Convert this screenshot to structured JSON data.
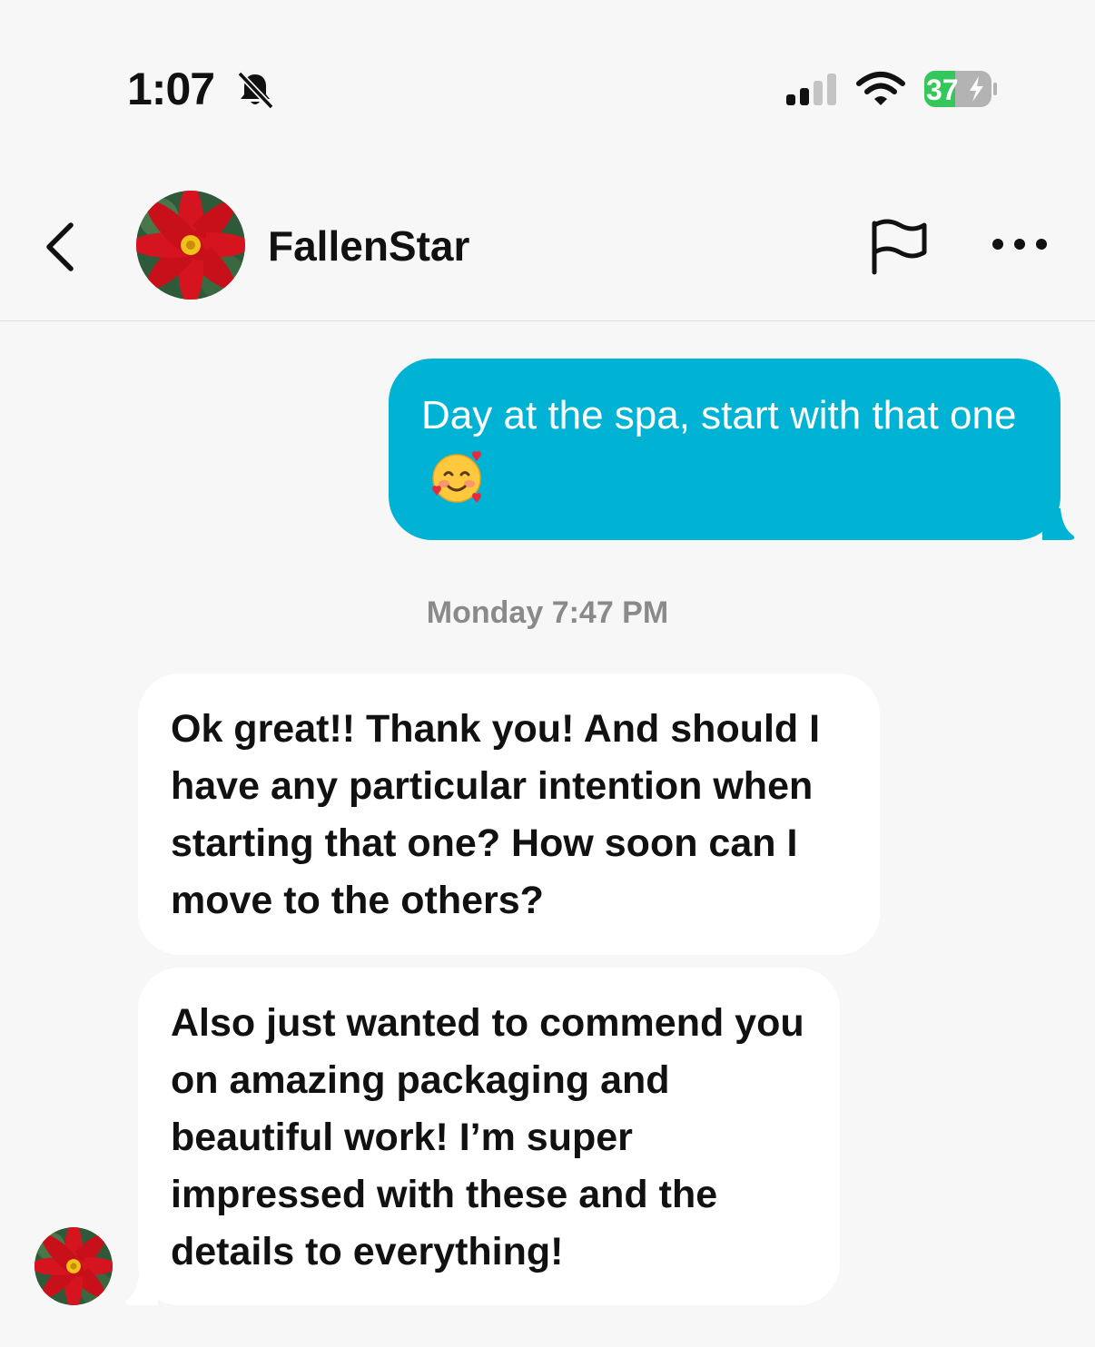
{
  "status_bar": {
    "time": "1:07",
    "battery_level": "37",
    "icons": [
      "bell-slash-icon",
      "cellular-signal-icon",
      "wifi-icon",
      "battery-charging-icon"
    ]
  },
  "header": {
    "contact_name": "FallenStar",
    "icons": [
      "back-chevron-icon",
      "flag-icon",
      "more-icon"
    ]
  },
  "messages": [
    {
      "direction": "outgoing",
      "text": "Day at the spa, start with that one",
      "emoji": "smiling-face-with-hearts"
    },
    {
      "direction": "incoming",
      "text": "Ok great!! Thank you! And should I have any particular intention when starting that one? How soon can I move to the others?"
    },
    {
      "direction": "incoming",
      "text": "Also just wanted to commend you on amazing packaging and beautiful work! I’m super impressed with these and the details to everything!"
    }
  ],
  "timestamp": "Monday 7:47 PM",
  "colors": {
    "outgoing_bubble": "#00b3d4",
    "incoming_bubble": "#ffffff",
    "background": "#f7f7f7",
    "battery_fill": "#34c759"
  }
}
